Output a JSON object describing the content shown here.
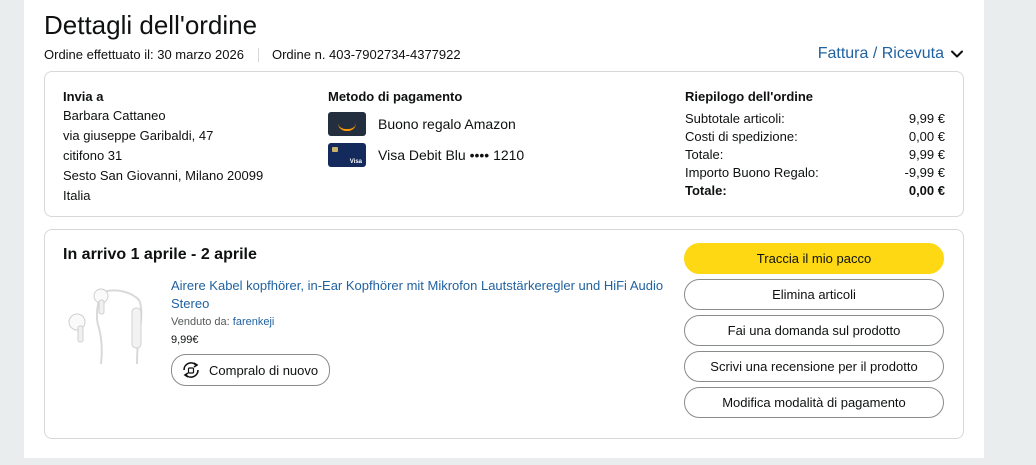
{
  "header": {
    "title": "Dettagli dell'ordine",
    "order_date": "Ordine effettuato il: 30 marzo 2026",
    "order_number": "Ordine n. 403-7902734-4377922",
    "invoice_link": "Fattura / Ricevuta"
  },
  "ship_to": {
    "heading": "Invia a",
    "lines": [
      "Barbara Cattaneo",
      "via giuseppe Garibaldi, 47",
      "citifono 31",
      "Sesto San Giovanni, Milano 20099",
      "Italia"
    ]
  },
  "payment": {
    "heading": "Metodo di pagamento",
    "methods": [
      {
        "label": "Buono regalo Amazon",
        "icon": "amazon-gift-card-icon"
      },
      {
        "label": "Visa Debit Blu •••• 1210",
        "icon": "visa-card-icon",
        "mini": "Visa"
      }
    ]
  },
  "summary": {
    "heading": "Riepilogo dell'ordine",
    "rows": [
      {
        "label": "Subtotale articoli:",
        "value": "9,99 €"
      },
      {
        "label": "Costi di spedizione:",
        "value": "0,00 €"
      },
      {
        "label": "Totale:",
        "value": "9,99 €"
      },
      {
        "label": "Importo Buono Regalo:",
        "value": "-9,99 €"
      },
      {
        "label": "Totale:",
        "value": "0,00 €"
      }
    ]
  },
  "shipment": {
    "arrival": "In arrivo 1 aprile - 2 aprile",
    "product_title": "Airere Kabel kopfhörer, in-Ear Kopfhörer mit Mikrofon Lautstärkeregler und HiFi Audio Stereo",
    "sold_by_label": "Venduto da:",
    "seller": "farenkeji",
    "price": "9,99€",
    "buy_again": "Compralo di nuovo",
    "actions": [
      "Traccia il mio pacco",
      "Elimina articoli",
      "Fai una domanda sul prodotto",
      "Scrivi una recensione per il prodotto",
      "Modifica modalità di pagamento"
    ]
  },
  "colors": {
    "link": "#2162a1",
    "primary_button": "#ffd814",
    "border": "#d5d9d9",
    "background": "#eaeded"
  }
}
